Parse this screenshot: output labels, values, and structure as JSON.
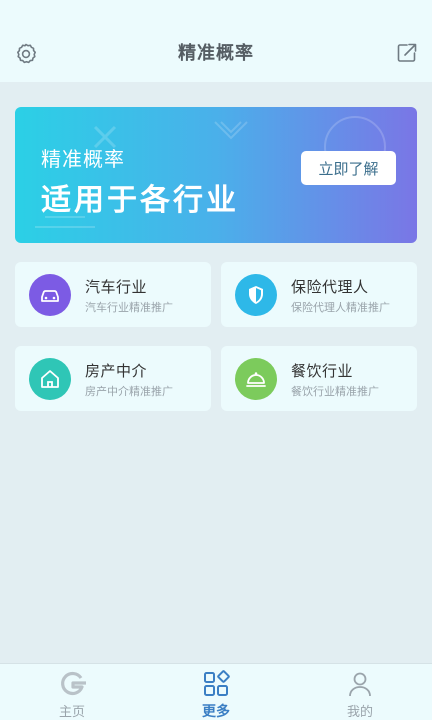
{
  "header": {
    "title": "精准概率",
    "left_icon": "gear-icon",
    "right_icon": "share-icon"
  },
  "banner": {
    "subtitle": "精准概率",
    "headline": "适用于各行业",
    "button_label": "立即了解",
    "gradient": [
      "#2bd0e6",
      "#4ab0ea",
      "#7a76e6"
    ]
  },
  "industries": [
    {
      "name": "汽车行业",
      "desc": "汽车行业精准推广",
      "icon": "car-icon",
      "color": "#7c5be4"
    },
    {
      "name": "保险代理人",
      "desc": "保险代理人精准推广",
      "icon": "shield-icon",
      "color": "#2eb8e8"
    },
    {
      "name": "房产中介",
      "desc": "房产中介精准推广",
      "icon": "house-icon",
      "color": "#2fc6b6"
    },
    {
      "name": "餐饮行业",
      "desc": "餐饮行业精准推广",
      "icon": "cloche-icon",
      "color": "#7ccb5c"
    }
  ],
  "tabbar": {
    "items": [
      {
        "label": "主页",
        "icon": "home-g-icon",
        "active": false
      },
      {
        "label": "更多",
        "icon": "grid-icon",
        "active": true
      },
      {
        "label": "我的",
        "icon": "user-icon",
        "active": false
      }
    ],
    "active_color": "#3b7fc4",
    "inactive_color": "#9aa4ab"
  }
}
